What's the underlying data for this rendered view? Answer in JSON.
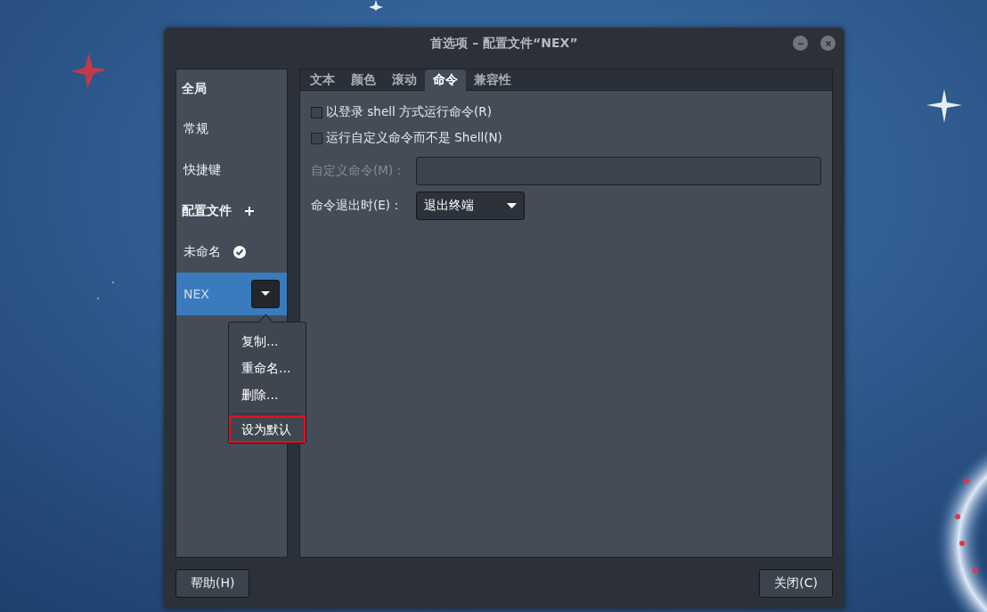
{
  "window": {
    "title": "首选项 – 配置文件“NEX”"
  },
  "sidebar": {
    "items": [
      {
        "kind": "header",
        "label": "全局"
      },
      {
        "kind": "item",
        "label": "常规",
        "selected": false
      },
      {
        "kind": "item",
        "label": "快捷键",
        "selected": false
      },
      {
        "kind": "header",
        "label": "配置文件",
        "add": true
      },
      {
        "kind": "profile",
        "label": "未命名",
        "selected": false,
        "default": true
      },
      {
        "kind": "profile",
        "label": "NEX",
        "selected": true,
        "default": false
      }
    ]
  },
  "profile_menu": {
    "items": [
      {
        "kind": "item",
        "label": "复制…",
        "highlighted": false
      },
      {
        "kind": "item",
        "label": "重命名…",
        "highlighted": false
      },
      {
        "kind": "item",
        "label": "删除…",
        "highlighted": false
      },
      {
        "kind": "separator"
      },
      {
        "kind": "item",
        "label": "设为默认",
        "highlighted": true
      }
    ]
  },
  "tabs": [
    {
      "label": "文本",
      "selected": false
    },
    {
      "label": "颜色",
      "selected": false
    },
    {
      "label": "滚动",
      "selected": false
    },
    {
      "label": "命令",
      "selected": true
    },
    {
      "label": "兼容性",
      "selected": false
    }
  ],
  "command": {
    "checkboxes": [
      {
        "label": "以登录 shell 方式运行命令(R)",
        "checked": false
      },
      {
        "label": "运行自定义命令而不是 Shell(N)",
        "checked": false
      }
    ],
    "custom_command": {
      "label": "自定义命令(M)：",
      "disabled": true
    },
    "exit_action": {
      "label": "命令退出时(E)：",
      "value": "退出终端"
    }
  },
  "buttons": [
    {
      "label": "帮助(H)"
    },
    {
      "label": "关闭(C)"
    }
  ]
}
